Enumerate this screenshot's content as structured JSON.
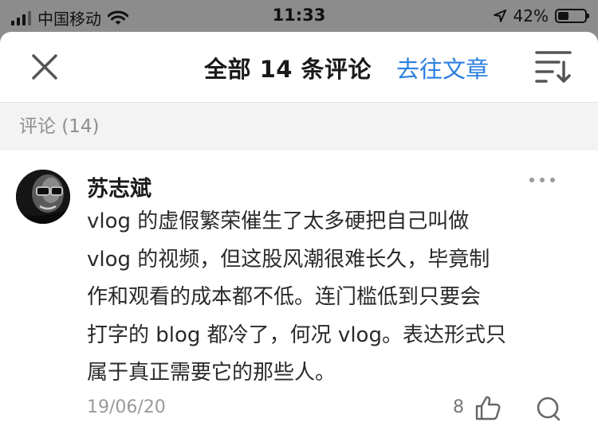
{
  "status_bar": {
    "carrier": "中国移动",
    "time": "11:33",
    "battery_percent": "42%",
    "battery_level": 0.42
  },
  "nav": {
    "close_icon": "close-icon",
    "title": "全部 14 条评论",
    "link_label": "去往文章",
    "sort_icon": "sort-icon",
    "link_color": "#2b7fe0"
  },
  "section": {
    "header": "评论 (14)"
  },
  "comment": {
    "author": "苏志斌",
    "lines": [
      "vlog 的虚假繁荣催生了太多硬把自己叫做",
      "vlog 的视频，但这股风潮很难长久，毕竟制",
      "作和观看的成本都不低。连门槛低到只要会",
      "打字的 blog 都冷了，何况 vlog。表达形式只",
      "属于真正需要它的那些人。"
    ],
    "date": "19/06/20",
    "like_count": "8"
  }
}
